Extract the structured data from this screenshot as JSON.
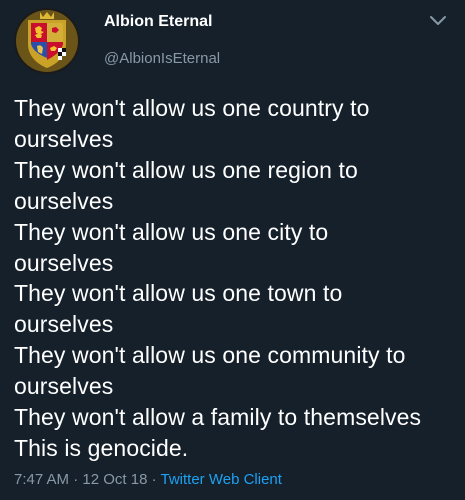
{
  "colors": {
    "background": "#15202b",
    "text_primary": "#ffffff",
    "text_secondary": "#8899a6",
    "link": "#1da1f2"
  },
  "author": {
    "display_name": "Albion Eternal",
    "handle": "@AlbionIsEternal",
    "avatar_icon": "royal-coat-of-arms-icon"
  },
  "menu": {
    "icon": "chevron-down-icon"
  },
  "tweet": {
    "lines": [
      "They won't allow us one country to",
      "ourselves",
      "They won't allow us one region to",
      "ourselves",
      "They won't allow us one city to",
      "ourselves",
      "They won't allow us one town to",
      "ourselves",
      "They won't allow us one community to",
      "ourselves",
      "They won't allow a family to themselves",
      "This is genocide."
    ]
  },
  "meta": {
    "time": "7:47 AM",
    "separator": " · ",
    "date": "12 Oct 18",
    "client": "Twitter Web Client"
  }
}
